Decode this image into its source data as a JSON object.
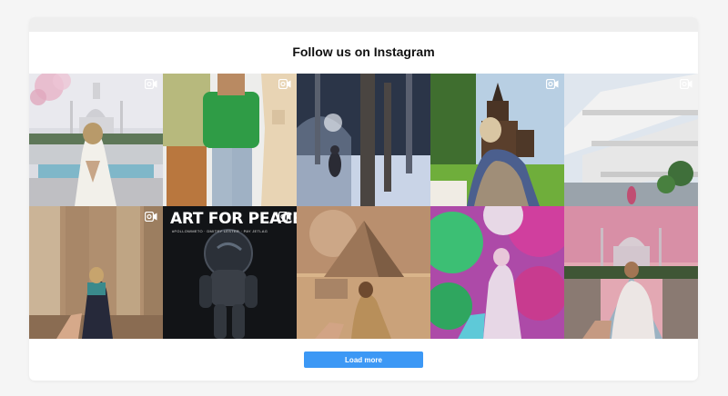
{
  "widget": {
    "title": "Follow us on Instagram",
    "load_more_label": "Load more"
  },
  "posts": [
    {
      "alt": "Woman in white dress facing the Taj Mahal",
      "has_reel_icon": true
    },
    {
      "alt": "Three people in colorful t-shirts",
      "has_reel_icon": true
    },
    {
      "alt": "Person walking in a snowy forest",
      "has_reel_icon": false
    },
    {
      "alt": "Woman leading toward a wooden church",
      "has_reel_icon": true
    },
    {
      "alt": "Modern white building with patterned facade",
      "has_reel_icon": true
    },
    {
      "alt": "Woman leading through ancient Egyptian temple columns",
      "has_reel_icon": true
    },
    {
      "alt": "Astronaut poster",
      "has_reel_icon": true,
      "overlay_text": "ART FOR PEACE",
      "overlay_subtext": "#FOLLOWMETO · DMITRY LESTER · PAY JETLAG"
    },
    {
      "alt": "Woman walking toward pyramid and sphinx",
      "has_reel_icon": false
    },
    {
      "alt": "Woman in colorful powder festival",
      "has_reel_icon": false
    },
    {
      "alt": "Woman in white dress walking toward the Taj Mahal at sunset",
      "has_reel_icon": false
    }
  ],
  "colors": {
    "button": "#3c98f5",
    "page_background": "#f5f5f5",
    "card_background": "#ffffff"
  }
}
